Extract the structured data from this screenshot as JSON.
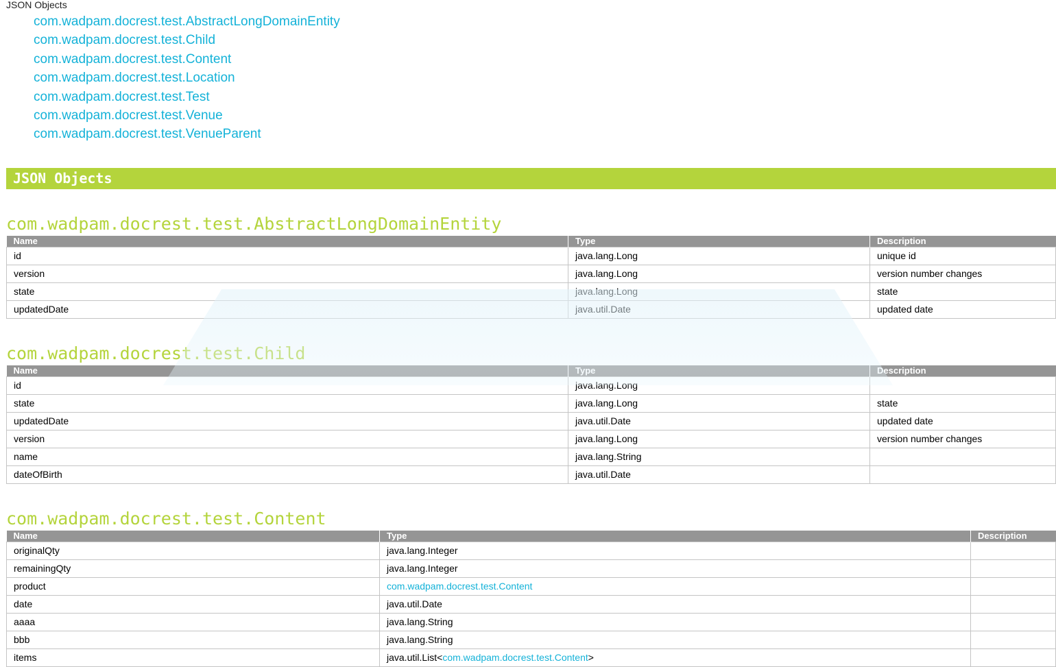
{
  "header": {
    "top_label": "JSON Objects"
  },
  "toc": {
    "items": [
      "com.wadpam.docrest.test.AbstractLongDomainEntity",
      "com.wadpam.docrest.test.Child",
      "com.wadpam.docrest.test.Content",
      "com.wadpam.docrest.test.Location",
      "com.wadpam.docrest.test.Test",
      "com.wadpam.docrest.test.Venue",
      "com.wadpam.docrest.test.VenueParent"
    ]
  },
  "section": {
    "title": "JSON Objects"
  },
  "columns": {
    "name": "Name",
    "type": "Type",
    "description": "Description"
  },
  "objects": [
    {
      "title": "com.wadpam.docrest.test.AbstractLongDomainEntity",
      "rows": [
        {
          "name": "id",
          "type": "java.lang.Long",
          "description": "unique id"
        },
        {
          "name": "version",
          "type": "java.lang.Long",
          "description": "version number changes"
        },
        {
          "name": "state",
          "type": "java.lang.Long",
          "description": "state"
        },
        {
          "name": "updatedDate",
          "type": "java.util.Date",
          "description": "updated date"
        }
      ]
    },
    {
      "title": "com.wadpam.docrest.test.Child",
      "rows": [
        {
          "name": "id",
          "type": "java.lang.Long",
          "description": ""
        },
        {
          "name": "state",
          "type": "java.lang.Long",
          "description": "state"
        },
        {
          "name": "updatedDate",
          "type": "java.util.Date",
          "description": "updated date"
        },
        {
          "name": "version",
          "type": "java.lang.Long",
          "description": "version number changes"
        },
        {
          "name": "name",
          "type": "java.lang.String",
          "description": ""
        },
        {
          "name": "dateOfBirth",
          "type": "java.util.Date",
          "description": ""
        }
      ]
    },
    {
      "title": "com.wadpam.docrest.test.Content",
      "rows": [
        {
          "name": "originalQty",
          "type": "java.lang.Integer",
          "description": ""
        },
        {
          "name": "remainingQty",
          "type": "java.lang.Integer",
          "description": ""
        },
        {
          "name": "product",
          "type_link": "com.wadpam.docrest.test.Content",
          "description": ""
        },
        {
          "name": "date",
          "type": "java.util.Date",
          "description": ""
        },
        {
          "name": "aaaa",
          "type": "java.lang.String",
          "description": ""
        },
        {
          "name": "bbb",
          "type": "java.lang.String",
          "description": ""
        },
        {
          "name": "items",
          "type_prefix": "java.util.List<",
          "type_link": "com.wadpam.docrest.test.Content",
          "type_suffix": ">",
          "description": ""
        }
      ]
    }
  ],
  "colors": {
    "accent": "#b4d43c",
    "link": "#14b2d8",
    "header_bg": "#959595"
  }
}
